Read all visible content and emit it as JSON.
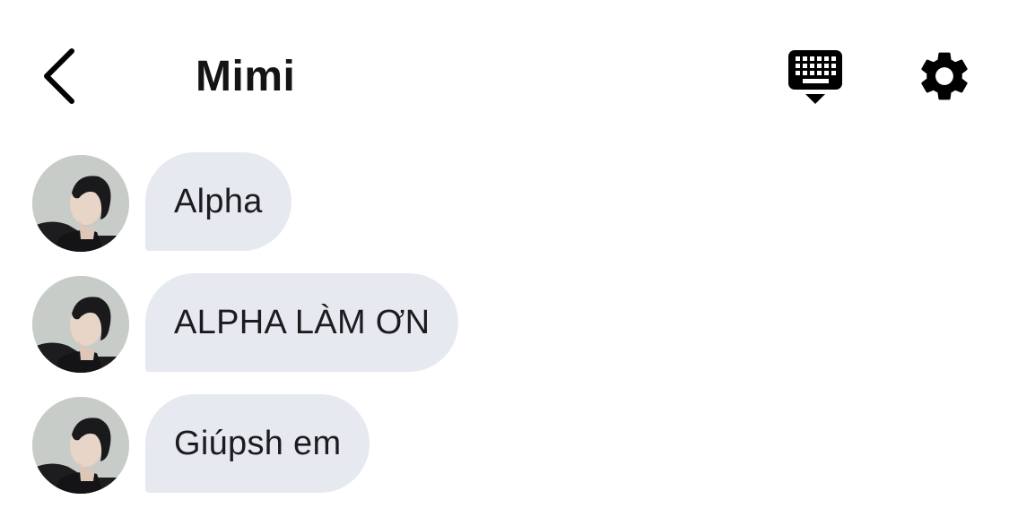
{
  "header": {
    "title": "Mimi",
    "back_icon": "chevron-left-icon",
    "keyboard_icon": "keyboard-icon",
    "settings_icon": "gear-icon"
  },
  "messages": [
    {
      "text": "Alpha",
      "sender_avatar": "avatar"
    },
    {
      "text": "ALPHA LÀM ƠN",
      "sender_avatar": "avatar"
    },
    {
      "text": "Giúpsh em",
      "sender_avatar": "avatar"
    }
  ],
  "colors": {
    "bubble": "#e6e9ef",
    "text": "#1c1c1e",
    "icon": "#000000",
    "background": "#ffffff"
  }
}
